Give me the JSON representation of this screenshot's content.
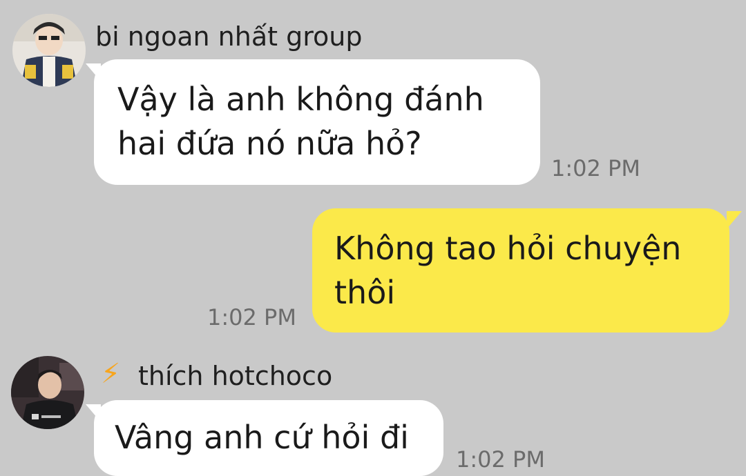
{
  "messages": [
    {
      "sender": "bi ngoan nhất group",
      "avatar": "player-photo-avatar",
      "lines": [
        "Vậy là anh không đánh",
        "hai đứa nó nữa hỏ?"
      ],
      "time": "1:02 PM",
      "direction": "incoming"
    },
    {
      "lines": [
        "Không tao hỏi chuyện",
        "thôi"
      ],
      "time": "1:02 PM",
      "direction": "outgoing"
    },
    {
      "sender": "thích hotchoco",
      "sender_icon": "lightning-bolt-icon",
      "avatar": "player-photo-avatar",
      "lines": [
        "Vâng anh cứ hỏi đi"
      ],
      "time": "1:02 PM",
      "direction": "incoming"
    }
  ],
  "colors": {
    "background": "#c9c9c9",
    "incoming_bubble": "#ffffff",
    "outgoing_bubble": "#fbe94a",
    "timestamp": "#6b6b6b",
    "bolt": "#f7a51d"
  }
}
